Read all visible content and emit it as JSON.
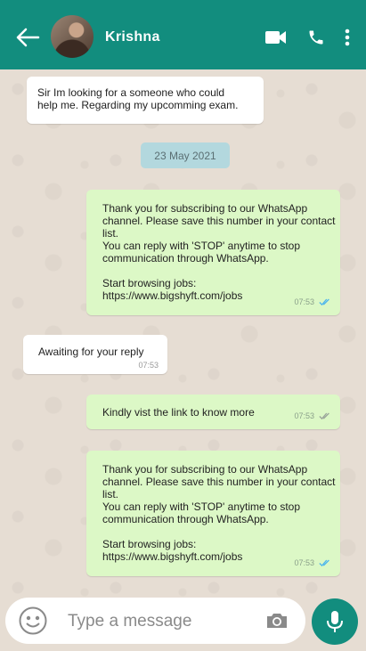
{
  "header": {
    "contact_name": "Krishna",
    "color": "#128d7e"
  },
  "messages": [
    {
      "direction": "in",
      "text": "Sir Im looking for a someone who could\nhelp me. Regarding my upcomming exam.",
      "time": ""
    },
    {
      "direction": "date",
      "text": "23 May 2021"
    },
    {
      "direction": "out",
      "text": "Thank you for subscribing to our WhatsApp\nchannel. Please save this number in your contact\nlist.\nYou can reply with 'STOP' anytime to stop\ncommunication through WhatsApp.\n\nStart browsing jobs:\nhttps://www.bigshyft.com/jobs",
      "time": "07:53",
      "status": "read"
    },
    {
      "direction": "in",
      "text": "Awaiting for your reply",
      "time": "07:53"
    },
    {
      "direction": "out",
      "text": "Kindly vist the link to know more",
      "time": "07:53",
      "status": "delivered"
    },
    {
      "direction": "out",
      "text": "Thank you for subscribing to our WhatsApp\nchannel. Please save this number in your contact\nlist.\nYou can reply with 'STOP' anytime to stop\ncommunication through WhatsApp.\n\nStart browsing jobs:\nhttps://www.bigshyft.com/jobs",
      "time": "07:53",
      "status": "read"
    }
  ],
  "input": {
    "placeholder": "Type a message"
  },
  "colors": {
    "incoming": "#ffffff",
    "outgoing": "#dcf8c6",
    "read_tick": "#4fb6ec",
    "delivered_tick": "#9aa59a"
  },
  "icons": [
    "back-arrow-icon",
    "video-call-icon",
    "phone-icon",
    "more-vert-icon",
    "emoji-icon",
    "camera-icon",
    "mic-icon"
  ]
}
